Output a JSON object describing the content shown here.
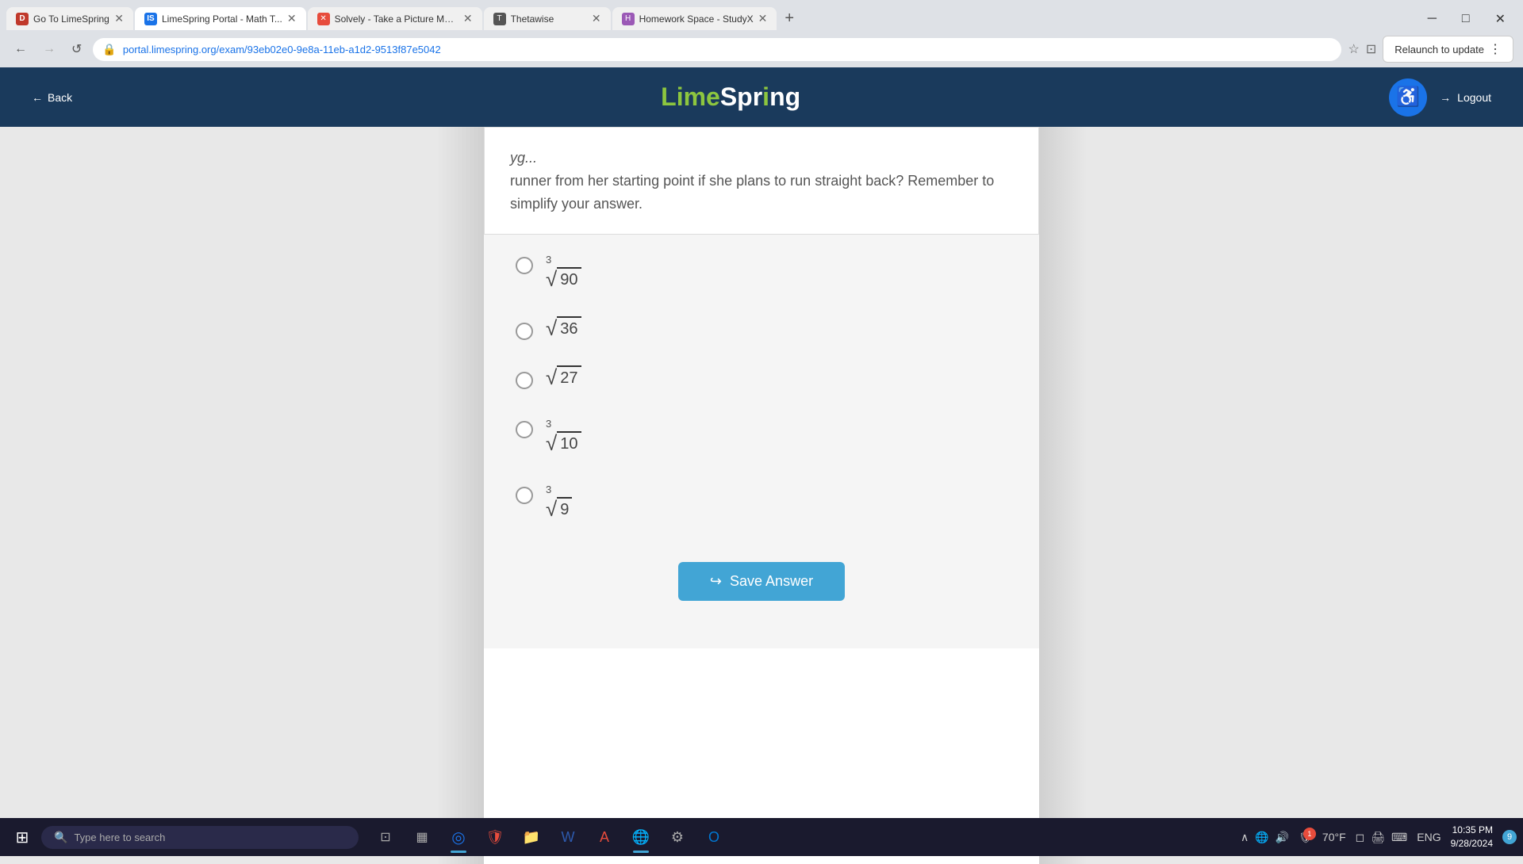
{
  "browser": {
    "tabs": [
      {
        "id": "tab1",
        "label": "Go To LimeSpring",
        "favicon_color": "#c0392b",
        "active": false
      },
      {
        "id": "tab2",
        "label": "LimeSpring Portal - Math T...",
        "favicon_color": "#1a73e8",
        "active": true
      },
      {
        "id": "tab3",
        "label": "Solvely - Take a Picture Mat...",
        "favicon_color": "#e74c3c",
        "active": false
      },
      {
        "id": "tab4",
        "label": "Thetawise",
        "favicon_color": "#555",
        "active": false
      },
      {
        "id": "tab5",
        "label": "Homework Space - StudyX",
        "favicon_color": "#9b59b6",
        "active": false
      }
    ],
    "url": "portal.limespring.org/exam/93eb02e0-9e8a-11eb-a1d2-9513f87e5042",
    "relaunch_label": "Relaunch to update"
  },
  "header": {
    "back_label": "Back",
    "logo_lime": "Lime",
    "logo_spring": "Spr",
    "logo_i": "i",
    "logo_ng": "ng",
    "logout_label": "Logout"
  },
  "question": {
    "text_partial": "runner from her starting point if she plans to run straight back? Remember to simplify your answer.",
    "options": [
      {
        "id": "opt1",
        "has_prefix": true,
        "prefix": "3",
        "radical_num": "90"
      },
      {
        "id": "opt2",
        "has_prefix": false,
        "radical_num": "36"
      },
      {
        "id": "opt3",
        "has_prefix": false,
        "radical_num": "27"
      },
      {
        "id": "opt4",
        "has_prefix": true,
        "prefix": "3",
        "radical_num": "10"
      },
      {
        "id": "opt5",
        "has_prefix": true,
        "prefix": "3",
        "radical_num": "9"
      }
    ]
  },
  "save_button": {
    "label": "Save Answer"
  },
  "taskbar": {
    "search_placeholder": "Type here to search",
    "time": "10:35 PM",
    "date": "9/28/2024",
    "temperature": "70°F",
    "language": "ENG",
    "notification_count": "9"
  }
}
